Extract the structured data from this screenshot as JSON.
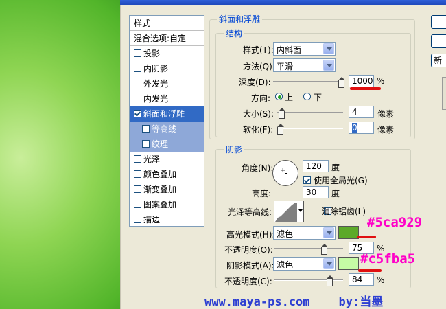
{
  "style_list": {
    "header": "样式",
    "items": [
      {
        "label": "混合选项:自定",
        "checkbox": false
      },
      {
        "label": "投影",
        "checkbox": true,
        "checked": false
      },
      {
        "label": "内阴影",
        "checkbox": true,
        "checked": false
      },
      {
        "label": "外发光",
        "checkbox": true,
        "checked": false
      },
      {
        "label": "内发光",
        "checkbox": true,
        "checked": false
      },
      {
        "label": "斜面和浮雕",
        "checkbox": true,
        "checked": true,
        "selected": true
      },
      {
        "label": "等高线",
        "checkbox": true,
        "checked": false,
        "sub": true
      },
      {
        "label": "纹理",
        "checkbox": true,
        "checked": false,
        "sub": true
      },
      {
        "label": "光泽",
        "checkbox": true,
        "checked": false
      },
      {
        "label": "颜色叠加",
        "checkbox": true,
        "checked": false
      },
      {
        "label": "渐变叠加",
        "checkbox": true,
        "checked": false
      },
      {
        "label": "图案叠加",
        "checkbox": true,
        "checked": false
      },
      {
        "label": "描边",
        "checkbox": true,
        "checked": false
      }
    ]
  },
  "bevel": {
    "title": "斜面和浮雕",
    "structure": {
      "title": "结构",
      "style_label": "样式(T):",
      "style_value": "内斜面",
      "technique_label": "方法(Q):",
      "technique_value": "平滑",
      "depth_label": "深度(D):",
      "depth_value": "1000",
      "depth_unit": "%",
      "depth_slider_fraction": 1.0,
      "direction_label": "方向:",
      "direction_up": "上",
      "direction_down": "下",
      "direction_selected": "up",
      "size_label": "大小(S):",
      "size_value": "4",
      "size_unit": "像素",
      "size_slider_fraction": 0.02,
      "soften_label": "软化(F):",
      "soften_value": "0",
      "soften_unit": "像素",
      "soften_slider_fraction": 0.0
    },
    "shading": {
      "title": "阴影",
      "angle_label": "角度(N):",
      "angle_value": "120",
      "angle_unit": "度",
      "global_light_label": "使用全局光(G)",
      "global_light_checked": true,
      "altitude_label": "高度:",
      "altitude_value": "30",
      "altitude_unit": "度",
      "gloss_contour_label": "光泽等高线:",
      "anti_alias_label": "消除锯齿(L)",
      "anti_alias_checked": false,
      "highlight_mode_label": "高光模式(H):",
      "highlight_mode_value": "滤色",
      "highlight_color": "#5ca929",
      "highlight_opacity_label": "不透明度(O):",
      "highlight_opacity_value": "75",
      "highlight_opacity_unit": "%",
      "highlight_opacity_fraction": 0.75,
      "shadow_mode_label": "阴影模式(A):",
      "shadow_mode_value": "滤色",
      "shadow_color": "#c5fba5",
      "shadow_opacity_label": "不透明度(C):",
      "shadow_opacity_value": "84",
      "shadow_opacity_unit": "%",
      "shadow_opacity_fraction": 0.84
    }
  },
  "buttons": {
    "new_style_label": "新"
  },
  "annotations": {
    "highlight_hex": "#5ca929",
    "shadow_hex": "#c5fba5"
  },
  "watermark": {
    "site": "www.maya-ps.com",
    "author": "by:当墨"
  },
  "colors": {
    "selection": "#316ac5",
    "group_title": "#0046d5",
    "annotation": "#ff00c8",
    "underline": "#e01010",
    "watermark": "#2d3fd2"
  }
}
